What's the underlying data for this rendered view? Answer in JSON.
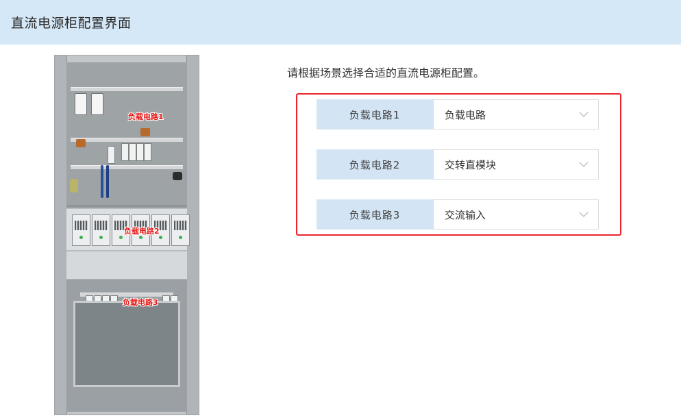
{
  "header": {
    "title": "直流电源柜配置界面"
  },
  "image": {
    "alt_marks": [
      "负载电路1",
      "负载电路2",
      "负载电路3"
    ]
  },
  "main": {
    "instruction": "请根据场景选择合适的直流电源柜配置。",
    "rows": [
      {
        "label": "负载电路1",
        "selected": "负载电路"
      },
      {
        "label": "负载电路2",
        "selected": "交转直模块"
      },
      {
        "label": "负载电路3",
        "selected": "交流输入"
      }
    ]
  },
  "colors": {
    "header_bg": "#d5e8f7",
    "label_bg": "#d3e5f4",
    "highlight_border": "#e8262c",
    "mark_text": "#e61a1a"
  },
  "icons": {
    "select_arrow": "chevron-down-icon"
  }
}
